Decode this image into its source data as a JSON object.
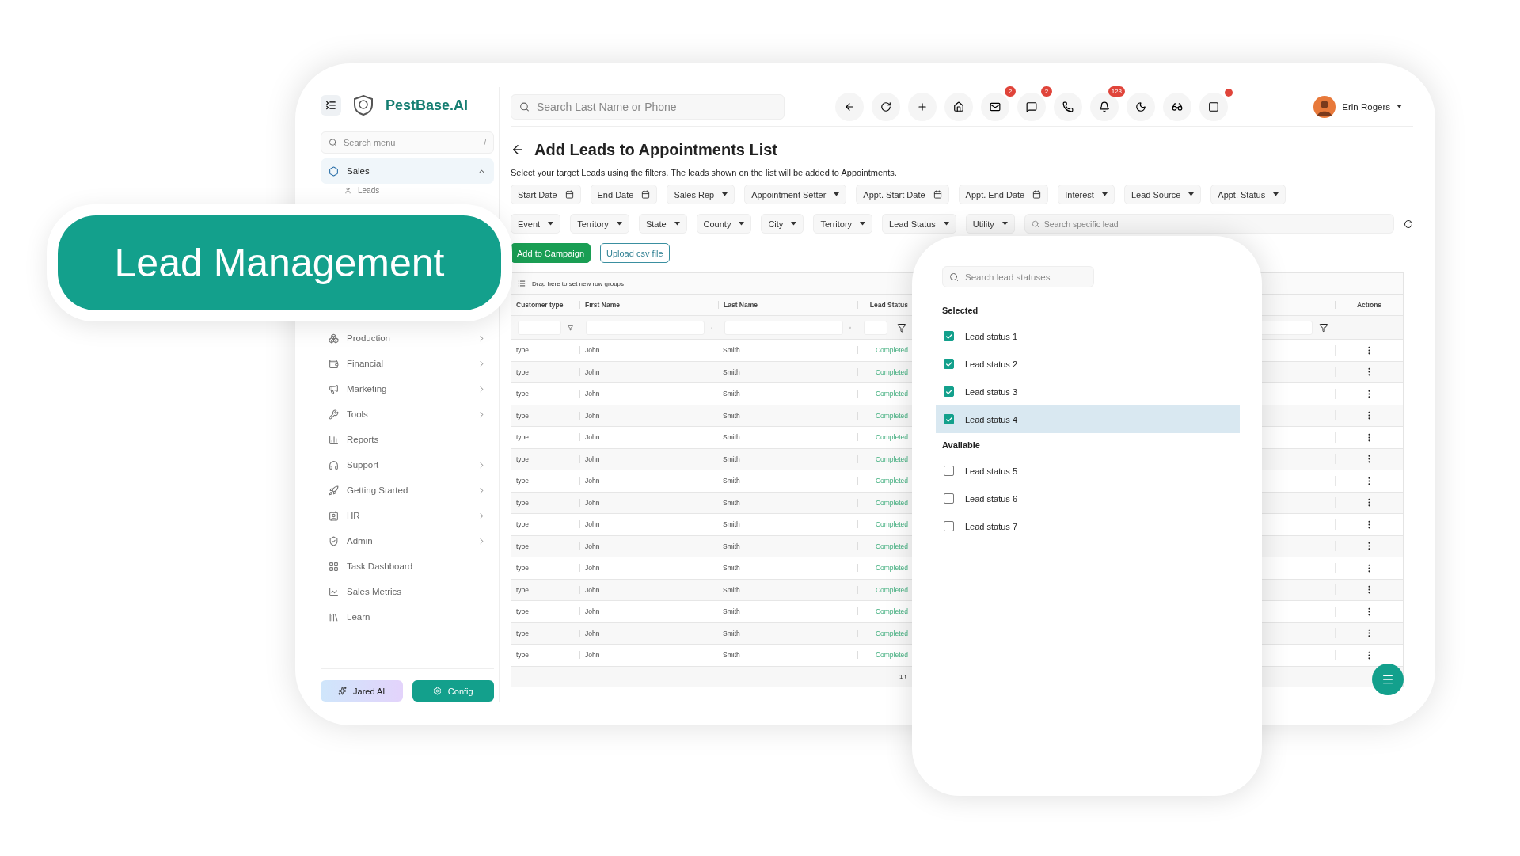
{
  "banner": {
    "title": "Lead Management"
  },
  "sidebar": {
    "brand": "PestBase.AI",
    "search": {
      "placeholder": "Search menu",
      "shortcut": "/"
    },
    "items": [
      {
        "label": "Sales",
        "submenu": true,
        "expanded": true,
        "selected": true,
        "children": [
          {
            "label": "Leads"
          }
        ]
      },
      {
        "label": "Production",
        "submenu": true,
        "expanded": false,
        "selected": false
      },
      {
        "label": "Financial",
        "submenu": true,
        "expanded": false,
        "selected": false
      },
      {
        "label": "Marketing",
        "submenu": true,
        "expanded": false,
        "selected": false
      },
      {
        "label": "Tools",
        "submenu": true,
        "expanded": false,
        "selected": false
      },
      {
        "label": "Reports",
        "submenu": false,
        "expanded": false,
        "selected": false
      },
      {
        "label": "Support",
        "submenu": true,
        "expanded": false,
        "selected": false
      },
      {
        "label": "Getting Started",
        "submenu": true,
        "expanded": false,
        "selected": false
      },
      {
        "label": "HR",
        "submenu": true,
        "expanded": false,
        "selected": false
      },
      {
        "label": "Admin",
        "submenu": true,
        "expanded": false,
        "selected": false
      },
      {
        "label": "Task Dashboard",
        "submenu": false,
        "expanded": false,
        "selected": false
      },
      {
        "label": "Sales Metrics",
        "submenu": false,
        "expanded": false,
        "selected": false
      },
      {
        "label": "Learn",
        "submenu": false,
        "expanded": false,
        "selected": false
      }
    ],
    "buttons": [
      {
        "label": "Jared AI",
        "kind": "ai"
      },
      {
        "label": "Config",
        "kind": "config"
      }
    ]
  },
  "topbar": {
    "search": {
      "placeholder": "Search Last Name or Phone"
    },
    "actions": [
      {
        "dot": false
      },
      {
        "dot": false
      },
      {
        "dot": false
      },
      {
        "dot": false
      },
      {
        "badge": "2",
        "dot": false
      },
      {
        "badge": "2",
        "dot": false
      },
      {
        "dot": false
      },
      {
        "badge": "123",
        "dot": false
      },
      {
        "dot": false
      },
      {
        "dot": false
      },
      {
        "dot": true
      }
    ],
    "user": {
      "name": "Erin Rogers"
    }
  },
  "page": {
    "title": "Add Leads to Appointments List",
    "description": "Select your target Leads using the filters. The leads shown on the list will be added to Appointments.",
    "filter_rows": [
      [
        {
          "label": "Start Date",
          "kind": "date"
        },
        {
          "label": "End Date",
          "kind": "date"
        },
        {
          "label": "Sales Rep",
          "kind": "select"
        },
        {
          "label": "Appointment Setter",
          "kind": "select"
        },
        {
          "label": "Appt. Start Date",
          "kind": "date"
        },
        {
          "label": "Appt. End Date",
          "kind": "date"
        },
        {
          "label": "Interest",
          "kind": "select"
        },
        {
          "label": "Lead Source",
          "kind": "select"
        },
        {
          "label": "Appt. Status",
          "kind": "select"
        }
      ],
      [
        {
          "label": "Event",
          "kind": "select"
        },
        {
          "label": "Territory",
          "kind": "select"
        },
        {
          "label": "State",
          "kind": "select"
        },
        {
          "label": "County",
          "kind": "select"
        },
        {
          "label": "City",
          "kind": "select"
        },
        {
          "label": "Territory",
          "kind": "select"
        },
        {
          "label": "Lead Status",
          "kind": "select"
        },
        {
          "label": "Utility",
          "kind": "select"
        }
      ]
    ],
    "lead_search": {
      "placeholder": "Search specific lead"
    },
    "buttons": [
      {
        "label": "Add to Campaign",
        "kind": "primary"
      },
      {
        "label": "Upload csv file",
        "kind": "outline"
      }
    ]
  },
  "table": {
    "group_hint": "Drag here to set new row groups",
    "columns": [
      "Customer type",
      "First Name",
      "Last Name",
      "Lead Status",
      "Actions"
    ],
    "rows": [
      {
        "customer_type": "type",
        "first_name": "John",
        "last_name": "Smith",
        "lead_status": "Completed"
      },
      {
        "customer_type": "type",
        "first_name": "John",
        "last_name": "Smith",
        "lead_status": "Completed"
      },
      {
        "customer_type": "type",
        "first_name": "John",
        "last_name": "Smith",
        "lead_status": "Completed"
      },
      {
        "customer_type": "type",
        "first_name": "John",
        "last_name": "Smith",
        "lead_status": "Completed"
      },
      {
        "customer_type": "type",
        "first_name": "John",
        "last_name": "Smith",
        "lead_status": "Completed"
      },
      {
        "customer_type": "type",
        "first_name": "John",
        "last_name": "Smith",
        "lead_status": "Completed"
      },
      {
        "customer_type": "type",
        "first_name": "John",
        "last_name": "Smith",
        "lead_status": "Completed"
      },
      {
        "customer_type": "type",
        "first_name": "John",
        "last_name": "Smith",
        "lead_status": "Completed"
      },
      {
        "customer_type": "type",
        "first_name": "John",
        "last_name": "Smith",
        "lead_status": "Completed"
      },
      {
        "customer_type": "type",
        "first_name": "John",
        "last_name": "Smith",
        "lead_status": "Completed"
      },
      {
        "customer_type": "type",
        "first_name": "John",
        "last_name": "Smith",
        "lead_status": "Completed"
      },
      {
        "customer_type": "type",
        "first_name": "John",
        "last_name": "Smith",
        "lead_status": "Completed"
      },
      {
        "customer_type": "type",
        "first_name": "John",
        "last_name": "Smith",
        "lead_status": "Completed"
      },
      {
        "customer_type": "type",
        "first_name": "John",
        "last_name": "Smith",
        "lead_status": "Completed"
      },
      {
        "customer_type": "type",
        "first_name": "John",
        "last_name": "Smith",
        "lead_status": "Completed"
      }
    ],
    "footer": "1 t"
  },
  "dropdown": {
    "search": {
      "placeholder": "Search lead statuses"
    },
    "groups": [
      {
        "title": "Selected",
        "options": [
          {
            "label": "Lead status 1",
            "checked": true,
            "selected": false
          },
          {
            "label": "Lead status 2",
            "checked": true,
            "selected": false
          },
          {
            "label": "Lead status 3",
            "checked": true,
            "selected": false
          },
          {
            "label": "Lead status 4",
            "checked": true,
            "selected": true
          }
        ]
      },
      {
        "title": "Available",
        "options": [
          {
            "label": "Lead status 5",
            "checked": false,
            "selected": false
          },
          {
            "label": "Lead status 6",
            "checked": false,
            "selected": false
          },
          {
            "label": "Lead status 7",
            "checked": false,
            "selected": false
          }
        ]
      }
    ]
  }
}
